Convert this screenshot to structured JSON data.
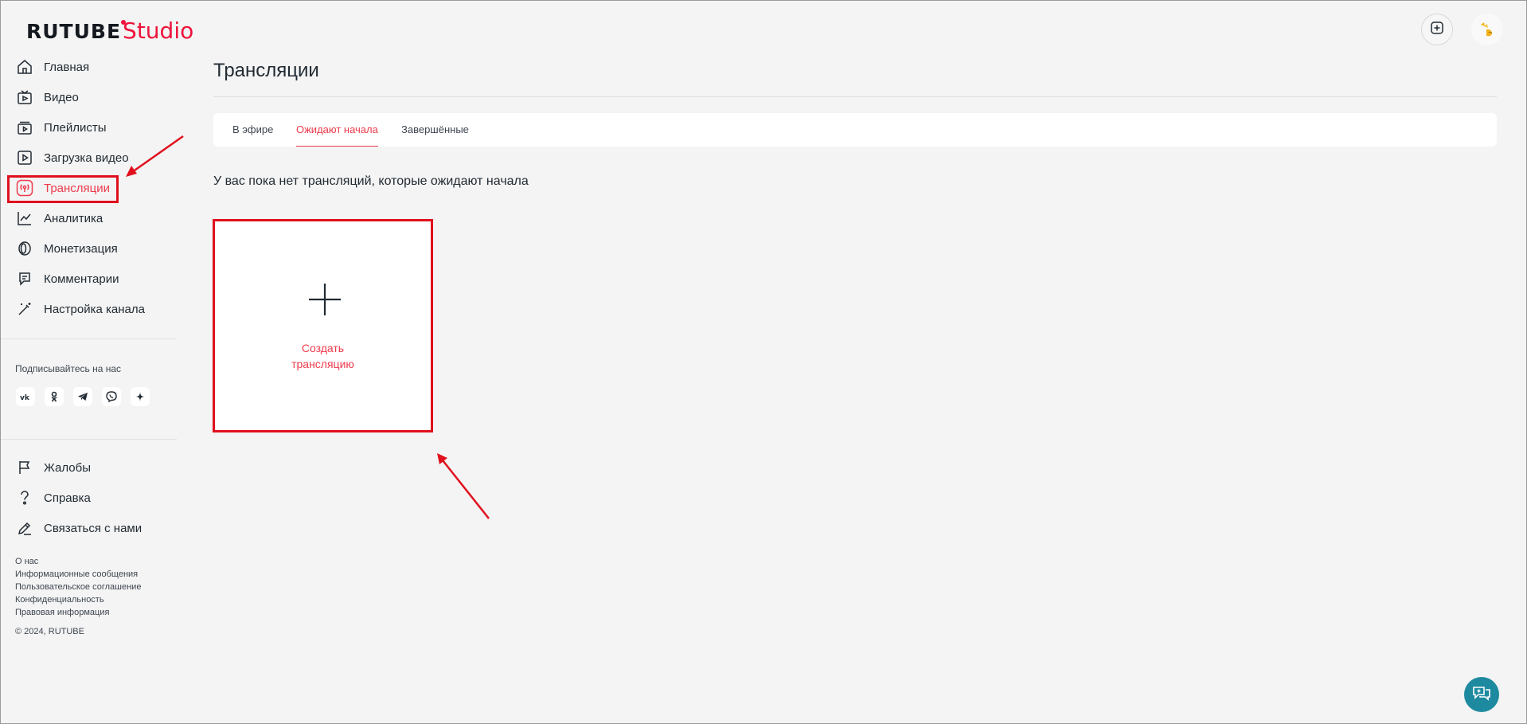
{
  "logo": {
    "brand": "RUTUBE",
    "product": "Studio"
  },
  "header": {
    "add_icon": "plus-square-icon",
    "avatar_icon": "avatar-image"
  },
  "sidebar": {
    "items": [
      {
        "label": "Главная",
        "icon": "home-icon"
      },
      {
        "label": "Видео",
        "icon": "video-icon"
      },
      {
        "label": "Плейлисты",
        "icon": "playlist-icon"
      },
      {
        "label": "Загрузка видео",
        "icon": "upload-icon"
      },
      {
        "label": "Трансляции",
        "icon": "broadcast-icon",
        "active": true
      },
      {
        "label": "Аналитика",
        "icon": "analytics-icon"
      },
      {
        "label": "Монетизация",
        "icon": "monetization-icon"
      },
      {
        "label": "Комментарии",
        "icon": "comments-icon"
      },
      {
        "label": "Настройка канала",
        "icon": "magic-wand-icon"
      }
    ],
    "follow_title": "Подписывайтесь на нас",
    "socials": [
      {
        "label": "VK",
        "icon": "vk-icon"
      },
      {
        "label": "OK",
        "icon": "ok-icon"
      },
      {
        "label": "Telegram",
        "icon": "telegram-icon"
      },
      {
        "label": "Viber",
        "icon": "viber-icon"
      },
      {
        "label": "Dzen",
        "icon": "dzen-icon"
      }
    ],
    "bottom_items": [
      {
        "label": "Жалобы",
        "icon": "flag-icon"
      },
      {
        "label": "Справка",
        "icon": "help-icon"
      },
      {
        "label": "Связаться с нами",
        "icon": "pencil-icon"
      }
    ],
    "footer_links": [
      "О нас",
      "Информационные сообщения",
      "Пользовательское соглашение",
      "Конфиденциальность",
      "Правовая информация"
    ],
    "copyright": "© 2024, RUTUBE"
  },
  "main": {
    "title": "Трансляции",
    "tabs": [
      {
        "label": "В эфире"
      },
      {
        "label": "Ожидают начала",
        "active": true
      },
      {
        "label": "Завершённые"
      }
    ],
    "empty_text": "У вас пока нет трансляций, которые ожидают начала",
    "create_card": {
      "line1": "Создать",
      "line2": "трансляцию"
    }
  },
  "colors": {
    "accent": "#ed3b4c",
    "annotation": "#e0101d",
    "background": "#f4f4f4",
    "chat": "#1e8aa0"
  }
}
